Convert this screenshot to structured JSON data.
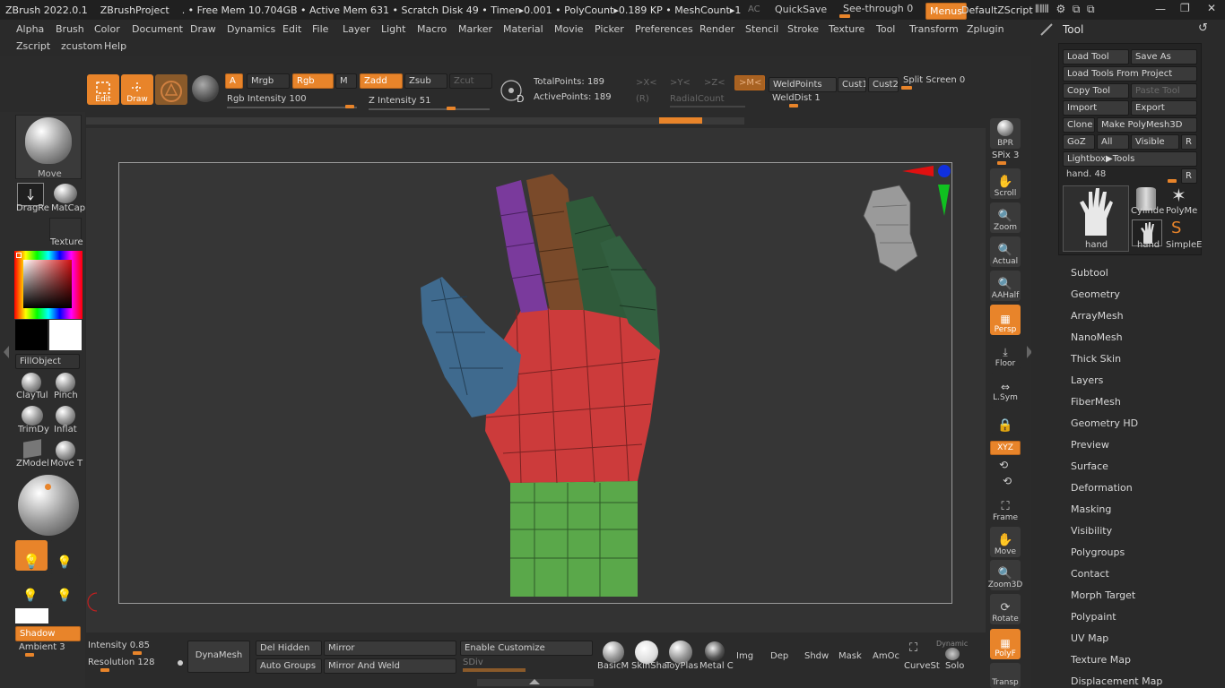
{
  "title_bar": {
    "app": "ZBrush 2022.0.1",
    "project": "ZBrushProject",
    "stats": ". • Free Mem 10.704GB • Active Mem 631 • Scratch Disk 49 •  Timer▸0.001 • PolyCount▸0.189 KP  • MeshCount▸1",
    "ac": "AC",
    "quicksave": "QuickSave",
    "see_through": "See-through  0",
    "menus": "Menus",
    "script": "DefaultZScript"
  },
  "menu": {
    "row1": [
      "Alpha",
      "Brush",
      "Color",
      "Document",
      "Draw",
      "Dynamics",
      "Edit",
      "File",
      "Layer",
      "Light",
      "Macro",
      "Marker",
      "Material",
      "Movie",
      "Picker",
      "Preferences",
      "Render",
      "Stencil",
      "Stroke",
      "Texture",
      "Tool",
      "Transform",
      "Zplugin"
    ],
    "row2": [
      "Zscript",
      "zcustom",
      "Help"
    ]
  },
  "toptools": {
    "edit": "Edit",
    "draw": "Draw",
    "a": "A",
    "mrgb": "Mrgb",
    "rgb": "Rgb",
    "m": "M",
    "zadd": "Zadd",
    "zsub": "Zsub",
    "zcut": "Zcut",
    "rgb_intensity": "Rgb Intensity 100",
    "z_intensity": "Z Intensity 51",
    "total_points": "TotalPoints: 189",
    "active_points": "ActivePoints: 189",
    "x": ">X<",
    "y": ">Y<",
    "z": ">Z<",
    "m2": ">M<",
    "r": "(R)",
    "radial": "RadialCount",
    "weld": "WeldPoints",
    "cust1": "Cust1",
    "cust2": "Cust2",
    "split": "Split Screen 0",
    "welddist": "WeldDist 1"
  },
  "left": {
    "move": "Move",
    "drag": "DragRe",
    "matcap": "MatCap",
    "texture": "Texture",
    "fill": "FillObject",
    "brushes": [
      "ClayTul",
      "Pinch",
      "TrimDy",
      "Inflat",
      "ZModel",
      "Move T"
    ],
    "shadow": "Shadow",
    "ambient": "Ambient 3"
  },
  "shelf": [
    "BPR",
    "SPix 3",
    "Scroll",
    "Zoom",
    "Actual",
    "AAHalf",
    "Persp",
    "Floor",
    "L.Sym",
    "",
    "XYZ",
    "",
    "",
    "Frame",
    "Move",
    "Zoom3D",
    "Rotate",
    "PolyF",
    "Transp"
  ],
  "bottom": {
    "intensity": "Intensity 0.85",
    "resolution": "Resolution 128",
    "dynamesh": "DynaMesh",
    "del_hidden": "Del Hidden",
    "auto_groups": "Auto Groups",
    "mirror": "Mirror",
    "mirror_weld": "Mirror And Weld",
    "enable_customize": "Enable Customize",
    "sdiv": "SDiv",
    "materials": [
      "BasicM",
      "SkinSha",
      "ToyPlas",
      "Metal C"
    ],
    "toggles": [
      "Img",
      "Dep",
      "Shdw",
      "Mask",
      "AmOc"
    ],
    "curvestrip": "CurveSt",
    "dynamic": "Dynamic",
    "solo": "Solo"
  },
  "tool": {
    "title": "Tool",
    "load": "Load Tool",
    "save_as": "Save As",
    "load_from_project": "Load Tools From Project",
    "copy": "Copy Tool",
    "paste": "Paste Tool",
    "import": "Import",
    "export": "Export",
    "clone": "Clone",
    "make_polymesh": "Make PolyMesh3D",
    "goz": "GoZ",
    "all": "All",
    "visible": "Visible",
    "r": "R",
    "lightbox": "Lightbox▶Tools",
    "hand_slider": "hand. 48",
    "thumbs": [
      "hand",
      "Cylinde",
      "PolyMe",
      "hand",
      "SimpleE"
    ],
    "subpalettes": [
      "Subtool",
      "Geometry",
      "ArrayMesh",
      "NanoMesh",
      "Thick Skin",
      "Layers",
      "FiberMesh",
      "Geometry HD",
      "Preview",
      "Surface",
      "Deformation",
      "Masking",
      "Visibility",
      "Polygroups",
      "Contact",
      "Morph Target",
      "Polypaint",
      "UV Map",
      "Texture Map",
      "Displacement Map"
    ]
  }
}
